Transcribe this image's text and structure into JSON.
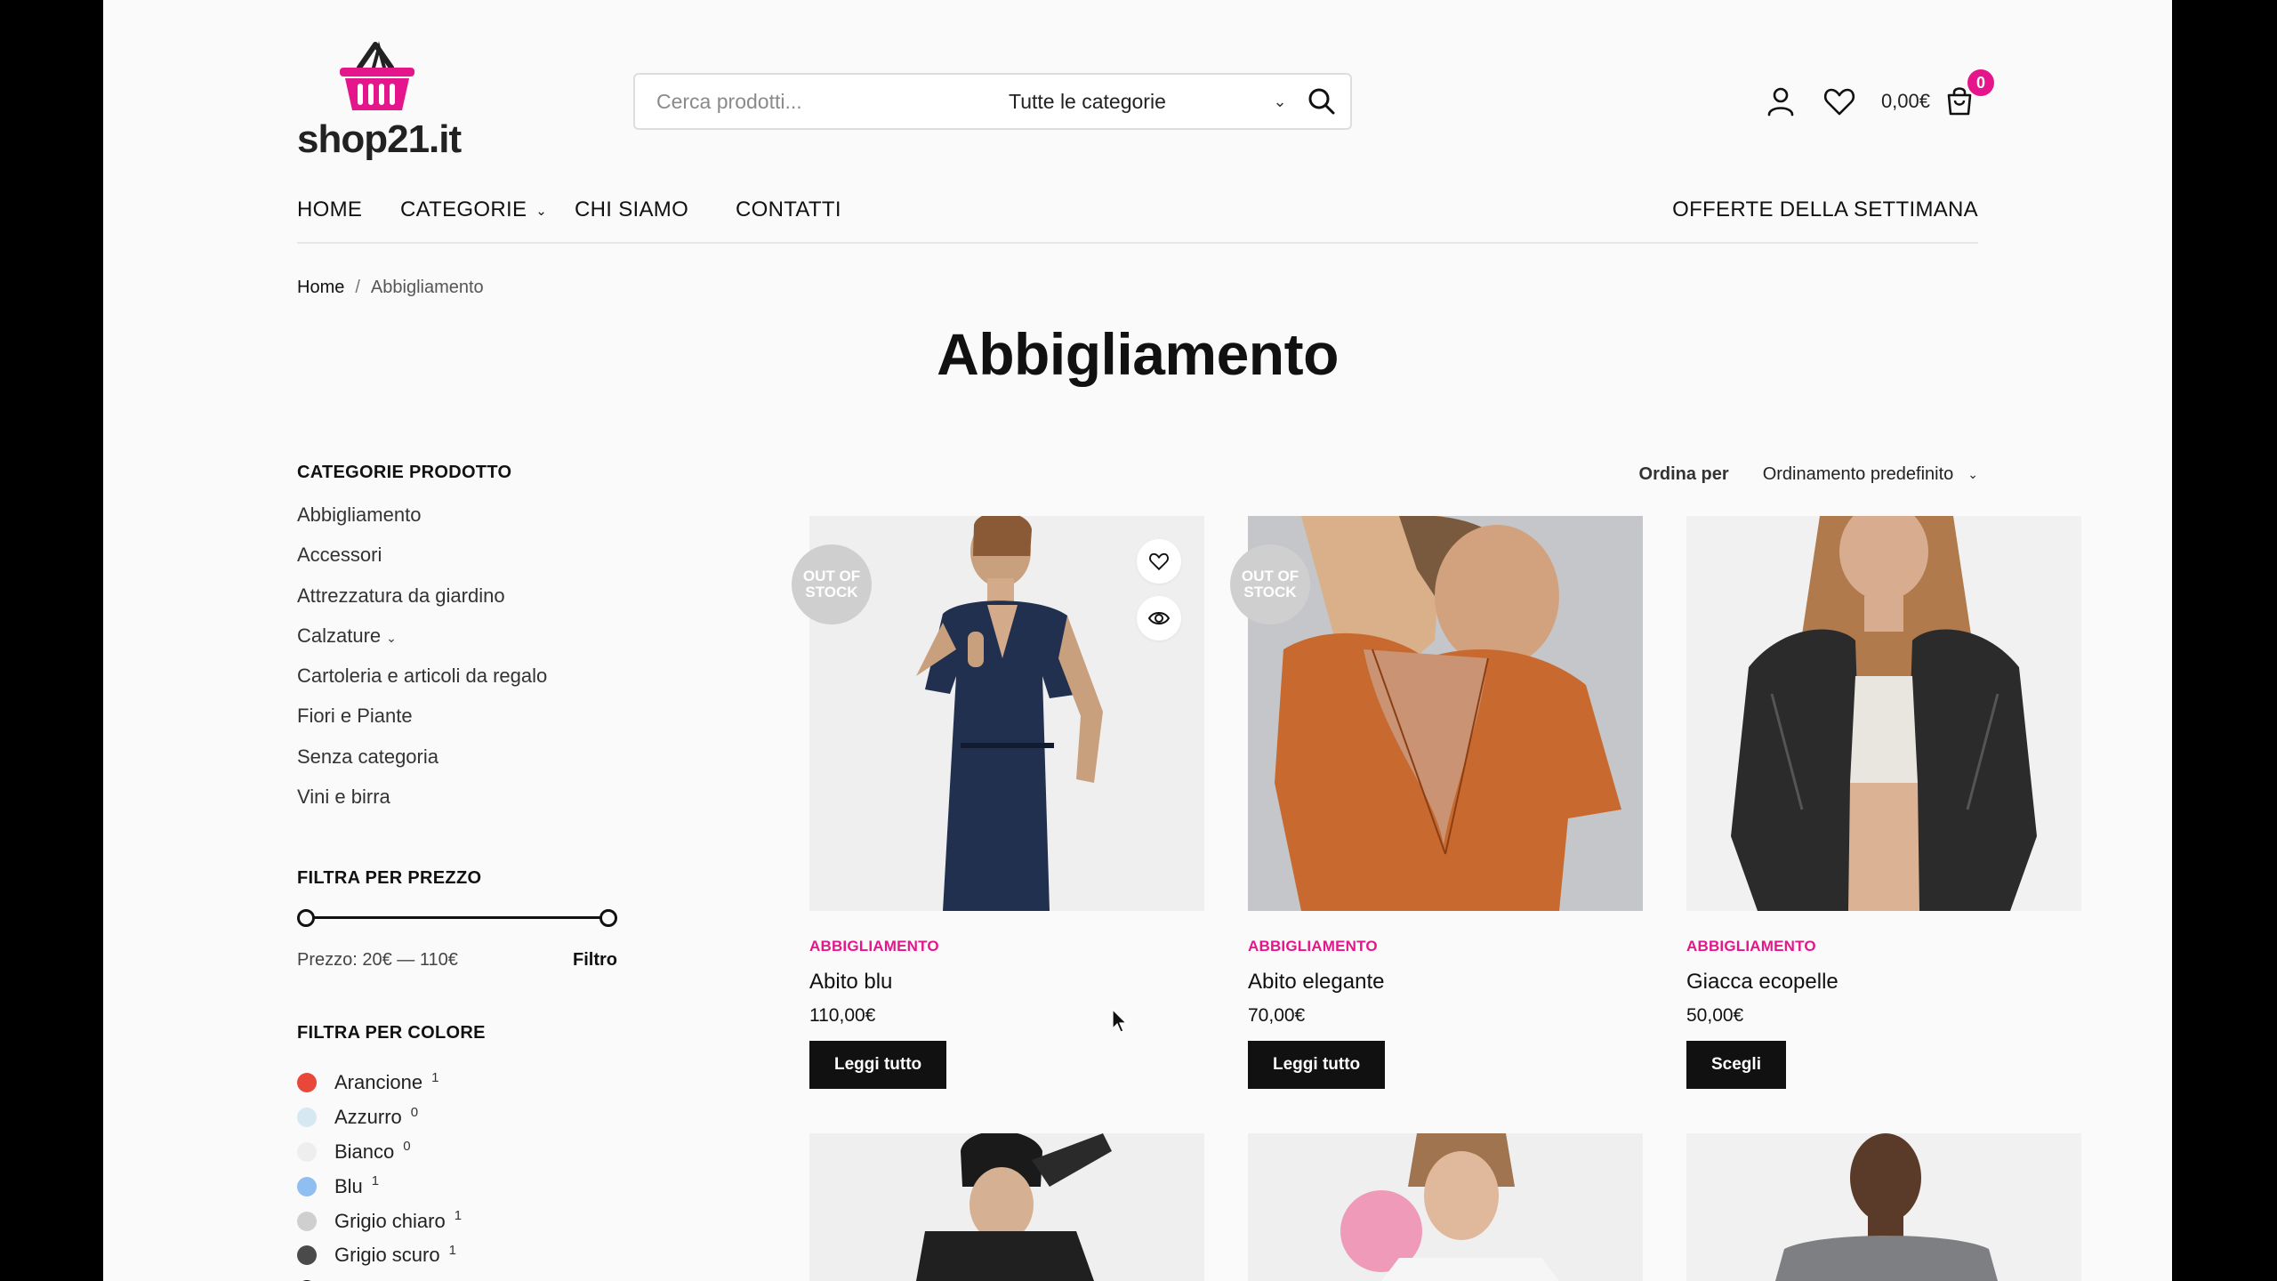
{
  "brand": {
    "logo_text": "shop21.it",
    "accent": "#e5168c"
  },
  "search": {
    "placeholder": "Cerca prodotti...",
    "category": "Tutte le categorie"
  },
  "header": {
    "cart_total": "0,00€",
    "cart_count": "0"
  },
  "nav": {
    "items": [
      "HOME",
      "CATEGORIE",
      "CHI SIAMO",
      "CONTATTI"
    ],
    "right": "OFFERTE DELLA SETTIMANA"
  },
  "breadcrumb": {
    "home": "Home",
    "separator": "/",
    "current": "Abbigliamento"
  },
  "page": {
    "title": "Abbigliamento"
  },
  "sidebar": {
    "categories_heading": "CATEGORIE PRODOTTO",
    "categories": [
      "Abbigliamento",
      "Accessori",
      "Attrezzatura da giardino",
      "Calzature",
      "Cartoleria e articoli da regalo",
      "Fiori e Piante",
      "Senza categoria",
      "Vini e birra"
    ],
    "price_heading": "FILTRA PER PREZZO",
    "price_range": "Prezzo: 20€ — 110€",
    "price_min": 20,
    "price_max": 110,
    "filter_label": "Filtro",
    "color_heading": "FILTRA PER COLORE",
    "colors": [
      {
        "name": "Arancione",
        "count": "1",
        "hex": "#e8473a"
      },
      {
        "name": "Azzurro",
        "count": "0",
        "hex": "#d6e8f2"
      },
      {
        "name": "Bianco",
        "count": "0",
        "hex": "#eeeeee"
      },
      {
        "name": "Blu",
        "count": "1",
        "hex": "#8fbff0"
      },
      {
        "name": "Grigio chiaro",
        "count": "1",
        "hex": "#cfcfcf"
      },
      {
        "name": "Grigio scuro",
        "count": "1",
        "hex": "#4a4a4a"
      }
    ]
  },
  "sort": {
    "label": "Ordina per",
    "value": "Ordinamento predefinito"
  },
  "products": [
    {
      "category": "ABBIGLIAMENTO",
      "name": "Abito blu",
      "price": "110,00€",
      "button": "Leggi tutto",
      "badge": "OUT OF STOCK"
    },
    {
      "category": "ABBIGLIAMENTO",
      "name": "Abito elegante",
      "price": "70,00€",
      "button": "Leggi tutto",
      "badge": "OUT OF STOCK"
    },
    {
      "category": "ABBIGLIAMENTO",
      "name": "Giacca ecopelle",
      "price": "50,00€",
      "button": "Scegli",
      "badge": ""
    }
  ]
}
